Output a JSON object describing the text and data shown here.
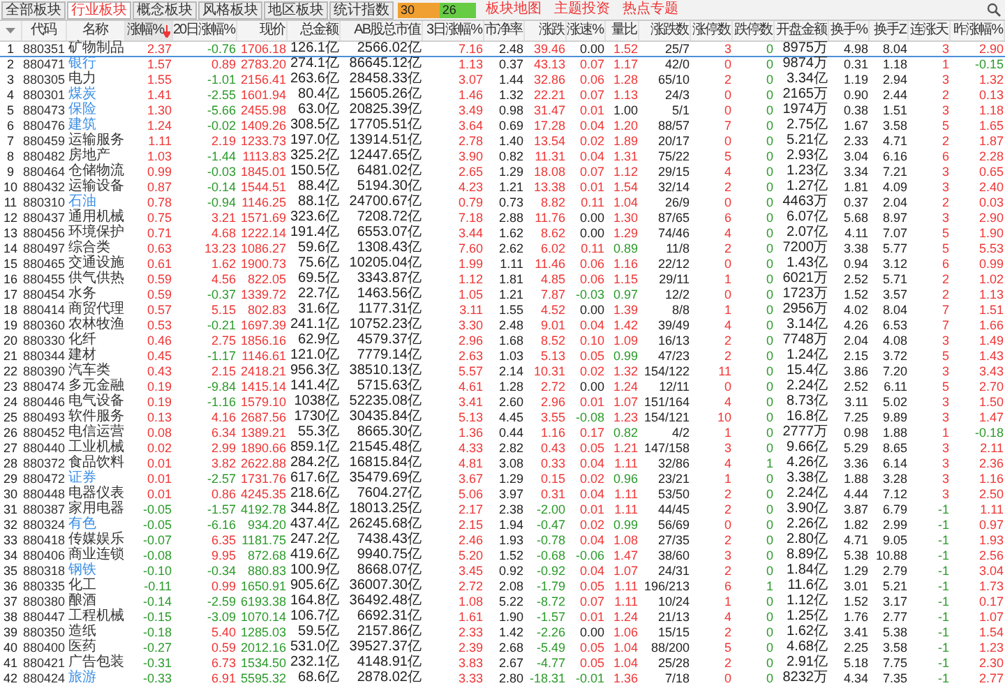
{
  "tabs": [
    {
      "label": "全部板块",
      "selected": false
    },
    {
      "label": "行业板块",
      "selected": true
    },
    {
      "label": "概念板块",
      "selected": false
    },
    {
      "label": "风格板块",
      "selected": false
    },
    {
      "label": "地区板块",
      "selected": false
    },
    {
      "label": "统计指数",
      "selected": false
    }
  ],
  "breadth": {
    "up_count": "30",
    "down_count": "26"
  },
  "links": [
    "板块地图",
    "主题投资",
    "热点专题"
  ],
  "columns": [
    {
      "label": "代码",
      "kind": "code",
      "sorted": false
    },
    {
      "label": "名称",
      "kind": "name",
      "sorted": false
    },
    {
      "label": "涨幅%",
      "kind": "sign",
      "sorted": true
    },
    {
      "label": "20日涨幅%",
      "kind": "sign",
      "sorted": false
    },
    {
      "label": "现价",
      "kind": "price",
      "sorted": false
    },
    {
      "label": "总金额",
      "kind": "plain",
      "sorted": false
    },
    {
      "label": "AB股总市值",
      "kind": "plain",
      "sorted": false
    },
    {
      "label": "3日涨幅%",
      "kind": "sign",
      "sorted": false
    },
    {
      "label": "市净率",
      "kind": "plain",
      "sorted": false
    },
    {
      "label": "涨跌",
      "kind": "sign",
      "sorted": false
    },
    {
      "label": "涨速%",
      "kind": "sign",
      "sorted": false
    },
    {
      "label": "量比",
      "kind": "ratio",
      "sorted": false
    },
    {
      "label": "涨跌数",
      "kind": "plain",
      "sorted": false
    },
    {
      "label": "涨停数",
      "kind": "up",
      "sorted": false
    },
    {
      "label": "跌停数",
      "kind": "down",
      "sorted": false
    },
    {
      "label": "开盘金额",
      "kind": "plain",
      "sorted": false
    },
    {
      "label": "换手%",
      "kind": "plain",
      "sorted": false
    },
    {
      "label": "换手Z",
      "kind": "plain",
      "sorted": false
    },
    {
      "label": "连涨天",
      "kind": "sign",
      "sorted": false
    },
    {
      "label": "昨涨幅%",
      "kind": "sign",
      "sorted": false
    }
  ],
  "rows": [
    {
      "index": "1",
      "code": "880351",
      "name": "矿物制品",
      "color": "#333333",
      "selected": true,
      "values": [
        "2.37",
        "-0.76",
        "1706.18",
        "126.1亿",
        "2566.02亿",
        "7.16",
        "2.48",
        "39.46",
        "0.00",
        "1.52",
        "25/7",
        "3",
        "0",
        "8975万",
        "4.98",
        "8.04",
        "3",
        "2.90"
      ]
    },
    {
      "index": "2",
      "code": "880471",
      "name": "银行",
      "color": "#3a8ee6",
      "selected": false,
      "values": [
        "1.57",
        "0.89",
        "2783.20",
        "274.1亿",
        "86645.12亿",
        "1.13",
        "0.37",
        "43.13",
        "0.07",
        "1.17",
        "42/0",
        "0",
        "0",
        "9874万",
        "0.31",
        "1.18",
        "1",
        "-0.15"
      ]
    },
    {
      "index": "3",
      "code": "880305",
      "name": "电力",
      "color": "#333333",
      "selected": false,
      "values": [
        "1.55",
        "-1.01",
        "2156.41",
        "263.6亿",
        "28458.33亿",
        "3.07",
        "1.44",
        "32.86",
        "0.06",
        "1.28",
        "65/10",
        "2",
        "0",
        "3.34亿",
        "1.19",
        "2.94",
        "3",
        "1.32"
      ]
    },
    {
      "index": "4",
      "code": "880301",
      "name": "煤炭",
      "color": "#3a8ee6",
      "selected": false,
      "values": [
        "1.41",
        "-2.55",
        "1601.94",
        "80.4亿",
        "15605.26亿",
        "1.46",
        "1.32",
        "22.21",
        "0.07",
        "1.13",
        "24/3",
        "0",
        "0",
        "2165万",
        "0.90",
        "2.44",
        "2",
        "0.13"
      ]
    },
    {
      "index": "5",
      "code": "880473",
      "name": "保险",
      "color": "#3a8ee6",
      "selected": false,
      "values": [
        "1.30",
        "-5.66",
        "2455.98",
        "63.0亿",
        "20825.39亿",
        "3.49",
        "0.98",
        "31.47",
        "0.01",
        "1.00",
        "5/1",
        "0",
        "0",
        "1974万",
        "0.38",
        "1.51",
        "3",
        "1.18"
      ]
    },
    {
      "index": "6",
      "code": "880476",
      "name": "建筑",
      "color": "#3a8ee6",
      "selected": false,
      "values": [
        "1.24",
        "-0.02",
        "1409.26",
        "308.5亿",
        "17705.51亿",
        "3.64",
        "0.69",
        "17.28",
        "0.04",
        "1.20",
        "88/57",
        "7",
        "0",
        "2.75亿",
        "1.67",
        "3.58",
        "5",
        "1.65"
      ]
    },
    {
      "index": "7",
      "code": "880459",
      "name": "运输服务",
      "color": "#333333",
      "selected": false,
      "values": [
        "1.11",
        "2.19",
        "1233.73",
        "197.0亿",
        "13914.51亿",
        "2.78",
        "1.40",
        "13.54",
        "0.02",
        "1.89",
        "20/17",
        "0",
        "0",
        "5.21亿",
        "2.33",
        "4.71",
        "2",
        "1.87"
      ]
    },
    {
      "index": "8",
      "code": "880482",
      "name": "房地产",
      "color": "#333333",
      "selected": false,
      "values": [
        "1.03",
        "-1.44",
        "1113.83",
        "325.2亿",
        "12447.65亿",
        "3.90",
        "0.82",
        "11.31",
        "0.04",
        "1.31",
        "75/22",
        "5",
        "0",
        "2.93亿",
        "3.04",
        "6.16",
        "6",
        "2.28"
      ]
    },
    {
      "index": "9",
      "code": "880464",
      "name": "仓储物流",
      "color": "#333333",
      "selected": false,
      "values": [
        "0.99",
        "-0.03",
        "1845.01",
        "150.5亿",
        "6481.02亿",
        "2.65",
        "1.29",
        "18.08",
        "0.07",
        "1.12",
        "29/15",
        "4",
        "0",
        "1.23亿",
        "3.34",
        "7.21",
        "3",
        "0.65"
      ]
    },
    {
      "index": "10",
      "code": "880432",
      "name": "运输设备",
      "color": "#333333",
      "selected": false,
      "values": [
        "0.87",
        "-0.14",
        "1544.51",
        "88.4亿",
        "5194.30亿",
        "4.23",
        "1.21",
        "13.38",
        "0.01",
        "1.54",
        "32/14",
        "2",
        "0",
        "1.27亿",
        "1.81",
        "4.09",
        "3",
        "2.40"
      ]
    },
    {
      "index": "11",
      "code": "880310",
      "name": "石油",
      "color": "#3a8ee6",
      "selected": false,
      "values": [
        "0.78",
        "-0.94",
        "1146.25",
        "88.1亿",
        "24700.67亿",
        "0.79",
        "0.73",
        "8.82",
        "0.11",
        "1.04",
        "26/9",
        "0",
        "0",
        "4463万",
        "0.37",
        "2.04",
        "2",
        "0.03"
      ]
    },
    {
      "index": "12",
      "code": "880437",
      "name": "通用机械",
      "color": "#333333",
      "selected": false,
      "values": [
        "0.75",
        "3.21",
        "1571.69",
        "323.6亿",
        "7208.72亿",
        "7.18",
        "2.88",
        "11.76",
        "0.00",
        "1.30",
        "87/65",
        "6",
        "0",
        "6.07亿",
        "5.68",
        "8.97",
        "3",
        "2.90"
      ]
    },
    {
      "index": "13",
      "code": "880456",
      "name": "环境保护",
      "color": "#333333",
      "selected": false,
      "values": [
        "0.71",
        "4.68",
        "1222.14",
        "191.4亿",
        "6553.07亿",
        "3.44",
        "1.62",
        "8.62",
        "0.00",
        "1.29",
        "74/46",
        "4",
        "0",
        "2.07亿",
        "4.11",
        "7.07",
        "5",
        "1.90"
      ]
    },
    {
      "index": "14",
      "code": "880497",
      "name": "综合类",
      "color": "#333333",
      "selected": false,
      "values": [
        "0.63",
        "13.23",
        "1086.27",
        "59.6亿",
        "1308.43亿",
        "7.60",
        "2.62",
        "6.02",
        "0.11",
        "0.89",
        "11/8",
        "2",
        "0",
        "7200万",
        "3.38",
        "5.77",
        "5",
        "5.53"
      ]
    },
    {
      "index": "15",
      "code": "880465",
      "name": "交通设施",
      "color": "#333333",
      "selected": false,
      "values": [
        "0.61",
        "1.62",
        "1900.73",
        "75.6亿",
        "10205.04亿",
        "1.99",
        "1.11",
        "11.46",
        "0.06",
        "1.16",
        "22/12",
        "0",
        "0",
        "1.43亿",
        "0.94",
        "3.12",
        "6",
        "0.99"
      ]
    },
    {
      "index": "16",
      "code": "880455",
      "name": "供气供热",
      "color": "#333333",
      "selected": false,
      "values": [
        "0.59",
        "4.56",
        "822.05",
        "69.5亿",
        "3343.87亿",
        "1.12",
        "1.81",
        "4.85",
        "0.06",
        "1.15",
        "29/11",
        "1",
        "0",
        "6021万",
        "2.52",
        "5.71",
        "2",
        "1.02"
      ]
    },
    {
      "index": "17",
      "code": "880454",
      "name": "水务",
      "color": "#333333",
      "selected": false,
      "values": [
        "0.59",
        "-0.37",
        "1339.72",
        "22.7亿",
        "1463.56亿",
        "1.05",
        "1.21",
        "7.87",
        "-0.03",
        "0.97",
        "12/2",
        "0",
        "0",
        "1723万",
        "1.52",
        "3.57",
        "2",
        "1.13"
      ]
    },
    {
      "index": "18",
      "code": "880414",
      "name": "商贸代理",
      "color": "#333333",
      "selected": false,
      "values": [
        "0.57",
        "5.15",
        "802.83",
        "31.6亿",
        "1177.31亿",
        "3.11",
        "1.55",
        "4.52",
        "0.00",
        "1.39",
        "8/8",
        "1",
        "0",
        "2956万",
        "4.02",
        "8.04",
        "7",
        "1.51"
      ]
    },
    {
      "index": "19",
      "code": "880360",
      "name": "农林牧渔",
      "color": "#333333",
      "selected": false,
      "values": [
        "0.53",
        "-0.21",
        "1697.39",
        "241.1亿",
        "10752.23亿",
        "3.30",
        "2.48",
        "9.01",
        "0.04",
        "1.42",
        "39/49",
        "4",
        "0",
        "3.14亿",
        "4.26",
        "6.53",
        "7",
        "1.66"
      ]
    },
    {
      "index": "20",
      "code": "880330",
      "name": "化纤",
      "color": "#333333",
      "selected": false,
      "values": [
        "0.46",
        "2.75",
        "1856.16",
        "62.9亿",
        "4579.37亿",
        "2.96",
        "1.68",
        "8.52",
        "0.10",
        "1.09",
        "16/13",
        "2",
        "0",
        "7748万",
        "2.04",
        "4.08",
        "3",
        "1.49"
      ]
    },
    {
      "index": "21",
      "code": "880344",
      "name": "建材",
      "color": "#333333",
      "selected": false,
      "values": [
        "0.45",
        "-1.17",
        "1146.61",
        "121.0亿",
        "7779.14亿",
        "2.63",
        "1.03",
        "5.13",
        "0.05",
        "0.99",
        "47/23",
        "2",
        "0",
        "1.24亿",
        "2.15",
        "3.72",
        "5",
        "1.43"
      ]
    },
    {
      "index": "22",
      "code": "880390",
      "name": "汽车类",
      "color": "#333333",
      "selected": false,
      "values": [
        "0.43",
        "2.15",
        "2418.21",
        "956.3亿",
        "38510.13亿",
        "5.57",
        "2.14",
        "10.31",
        "0.02",
        "1.32",
        "154/122",
        "11",
        "0",
        "15.4亿",
        "3.86",
        "7.20",
        "3",
        "3.43"
      ]
    },
    {
      "index": "23",
      "code": "880474",
      "name": "多元金融",
      "color": "#333333",
      "selected": false,
      "values": [
        "0.19",
        "-9.84",
        "1415.14",
        "141.4亿",
        "5715.63亿",
        "4.61",
        "1.28",
        "2.72",
        "0.00",
        "1.24",
        "12/11",
        "0",
        "0",
        "2.24亿",
        "2.52",
        "6.11",
        "5",
        "2.70"
      ]
    },
    {
      "index": "24",
      "code": "880446",
      "name": "电气设备",
      "color": "#333333",
      "selected": false,
      "values": [
        "0.19",
        "-1.16",
        "1579.10",
        "1038亿",
        "52235.08亿",
        "3.41",
        "2.60",
        "2.96",
        "0.01",
        "1.07",
        "151/164",
        "4",
        "0",
        "8.73亿",
        "3.11",
        "5.02",
        "3",
        "1.50"
      ]
    },
    {
      "index": "25",
      "code": "880493",
      "name": "软件服务",
      "color": "#333333",
      "selected": false,
      "values": [
        "0.13",
        "4.16",
        "2687.56",
        "1730亿",
        "30435.84亿",
        "5.13",
        "4.45",
        "3.55",
        "-0.08",
        "1.23",
        "154/121",
        "10",
        "0",
        "16.8亿",
        "7.25",
        "9.89",
        "3",
        "1.47"
      ]
    },
    {
      "index": "26",
      "code": "880452",
      "name": "电信运营",
      "color": "#333333",
      "selected": false,
      "values": [
        "0.08",
        "6.34",
        "1389.21",
        "55.3亿",
        "8665.30亿",
        "1.36",
        "0.44",
        "1.16",
        "0.17",
        "0.82",
        "4/2",
        "1",
        "0",
        "2777万",
        "0.98",
        "1.88",
        "1",
        "-0.18"
      ]
    },
    {
      "index": "27",
      "code": "880440",
      "name": "工业机械",
      "color": "#333333",
      "selected": false,
      "values": [
        "0.02",
        "2.99",
        "1890.66",
        "859.1亿",
        "21545.48亿",
        "4.33",
        "2.82",
        "0.43",
        "0.05",
        "1.21",
        "147/158",
        "3",
        "0",
        "9.66亿",
        "5.29",
        "8.65",
        "3",
        "2.11"
      ]
    },
    {
      "index": "28",
      "code": "880372",
      "name": "食品饮料",
      "color": "#333333",
      "selected": false,
      "values": [
        "0.01",
        "3.82",
        "2622.88",
        "284.2亿",
        "16815.84亿",
        "4.81",
        "3.08",
        "0.33",
        "0.04",
        "1.11",
        "32/86",
        "4",
        "1",
        "4.26亿",
        "3.36",
        "6.14",
        "3",
        "2.36"
      ]
    },
    {
      "index": "29",
      "code": "880472",
      "name": "证券",
      "color": "#3a8ee6",
      "selected": false,
      "values": [
        "0.01",
        "-2.57",
        "1731.76",
        "617.6亿",
        "35479.69亿",
        "3.67",
        "1.29",
        "0.15",
        "0.02",
        "0.96",
        "23/21",
        "1",
        "0",
        "3.38亿",
        "1.88",
        "3.28",
        "3",
        "1.16"
      ]
    },
    {
      "index": "30",
      "code": "880448",
      "name": "电器仪表",
      "color": "#333333",
      "selected": false,
      "values": [
        "0.01",
        "0.86",
        "4245.35",
        "218.6亿",
        "7604.27亿",
        "5.06",
        "3.97",
        "0.31",
        "0.04",
        "1.11",
        "53/50",
        "2",
        "0",
        "2.24亿",
        "4.44",
        "7.12",
        "3",
        "2.50"
      ]
    },
    {
      "index": "31",
      "code": "880387",
      "name": "家用电器",
      "color": "#333333",
      "selected": false,
      "values": [
        "-0.05",
        "-1.57",
        "4192.78",
        "344.8亿",
        "18013.25亿",
        "2.17",
        "2.38",
        "-2.00",
        "0.01",
        "1.11",
        "44/45",
        "2",
        "0",
        "3.90亿",
        "3.87",
        "6.79",
        "-1",
        "1.11"
      ]
    },
    {
      "index": "32",
      "code": "880324",
      "name": "有色",
      "color": "#3a8ee6",
      "selected": false,
      "values": [
        "-0.05",
        "-6.16",
        "934.20",
        "437.4亿",
        "26245.68亿",
        "2.15",
        "1.94",
        "-0.47",
        "0.02",
        "0.99",
        "56/69",
        "0",
        "0",
        "2.26亿",
        "1.82",
        "2.99",
        "-1",
        "0.97"
      ]
    },
    {
      "index": "33",
      "code": "880418",
      "name": "传媒娱乐",
      "color": "#333333",
      "selected": false,
      "values": [
        "-0.07",
        "6.35",
        "1181.75",
        "247.2亿",
        "7438.43亿",
        "2.46",
        "1.93",
        "-0.78",
        "0.04",
        "1.08",
        "27/35",
        "2",
        "0",
        "2.80亿",
        "4.71",
        "9.05",
        "-1",
        "1.93"
      ]
    },
    {
      "index": "34",
      "code": "880406",
      "name": "商业连锁",
      "color": "#333333",
      "selected": false,
      "values": [
        "-0.08",
        "9.95",
        "872.68",
        "419.6亿",
        "9940.75亿",
        "5.20",
        "1.52",
        "-0.68",
        "-0.06",
        "1.47",
        "38/60",
        "3",
        "0",
        "8.89亿",
        "5.38",
        "10.88",
        "-1",
        "2.56"
      ]
    },
    {
      "index": "35",
      "code": "880318",
      "name": "钢铁",
      "color": "#3a8ee6",
      "selected": false,
      "values": [
        "-0.10",
        "-0.34",
        "880.83",
        "100.9亿",
        "8668.07亿",
        "3.45",
        "0.92",
        "-0.92",
        "0.04",
        "1.07",
        "24/31",
        "2",
        "0",
        "1.84亿",
        "1.29",
        "2.79",
        "-1",
        "3.04"
      ]
    },
    {
      "index": "36",
      "code": "880335",
      "name": "化工",
      "color": "#333333",
      "selected": false,
      "values": [
        "-0.11",
        "0.99",
        "1650.91",
        "905.6亿",
        "36007.30亿",
        "2.72",
        "2.08",
        "-1.79",
        "0.05",
        "1.11",
        "196/213",
        "6",
        "1",
        "11.6亿",
        "3.01",
        "5.21",
        "-1",
        "1.73"
      ]
    },
    {
      "index": "37",
      "code": "880380",
      "name": "酿酒",
      "color": "#333333",
      "selected": false,
      "values": [
        "-0.14",
        "-2.59",
        "6193.38",
        "164.8亿",
        "36492.48亿",
        "1.08",
        "5.22",
        "-8.72",
        "0.07",
        "1.11",
        "10/24",
        "1",
        "0",
        "1.12亿",
        "1.52",
        "3.17",
        "-1",
        "0.17"
      ]
    },
    {
      "index": "38",
      "code": "880447",
      "name": "工程机械",
      "color": "#333333",
      "selected": false,
      "values": [
        "-0.15",
        "-3.09",
        "1070.14",
        "106.7亿",
        "6692.31亿",
        "1.61",
        "1.90",
        "-1.57",
        "0.01",
        "1.24",
        "21/13",
        "4",
        "0",
        "1.25亿",
        "1.76",
        "2.77",
        "-1",
        "1.07"
      ]
    },
    {
      "index": "39",
      "code": "880350",
      "name": "造纸",
      "color": "#333333",
      "selected": false,
      "values": [
        "-0.18",
        "5.40",
        "1285.03",
        "59.5亿",
        "2157.86亿",
        "2.33",
        "1.42",
        "-2.26",
        "0.00",
        "1.06",
        "15/15",
        "2",
        "0",
        "1.62亿",
        "3.41",
        "5.38",
        "-1",
        "1.54"
      ]
    },
    {
      "index": "40",
      "code": "880400",
      "name": "医药",
      "color": "#333333",
      "selected": false,
      "values": [
        "-0.27",
        "0.59",
        "2012.16",
        "531.0亿",
        "39527.37亿",
        "2.39",
        "2.68",
        "-5.49",
        "0.05",
        "1.04",
        "88/200",
        "5",
        "0",
        "4.68亿",
        "2.25",
        "3.58",
        "-1",
        "1.23"
      ]
    },
    {
      "index": "41",
      "code": "880421",
      "name": "广告包装",
      "color": "#333333",
      "selected": false,
      "values": [
        "-0.31",
        "6.73",
        "1534.50",
        "232.1亿",
        "4148.91亿",
        "3.83",
        "2.67",
        "-4.77",
        "0.05",
        "1.04",
        "25/28",
        "2",
        "0",
        "2.91亿",
        "5.18",
        "7.75",
        "-1",
        "2.30"
      ]
    },
    {
      "index": "42",
      "code": "880424",
      "name": "旅游",
      "color": "#3a8ee6",
      "selected": false,
      "values": [
        "-0.33",
        "6.91",
        "5595.32",
        "68.6亿",
        "2878.02亿",
        "3.33",
        "2.80",
        "-18.31",
        "-0.01",
        "1.36",
        "7/18",
        "0",
        "0",
        "8232万",
        "4.34",
        "7.35",
        "-1",
        "2.77"
      ]
    }
  ]
}
